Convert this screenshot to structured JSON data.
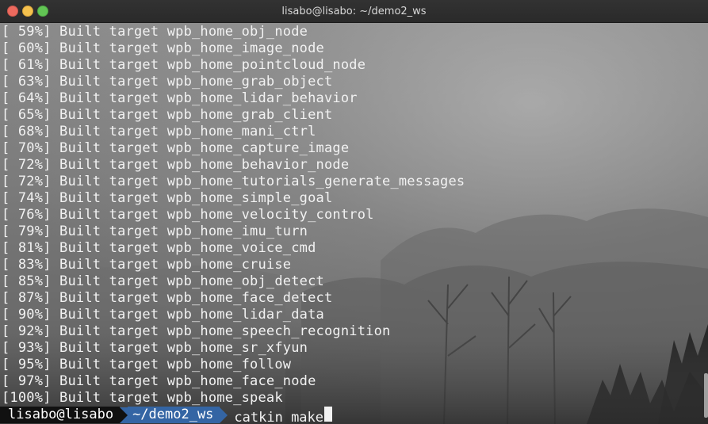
{
  "window": {
    "title": "lisabo@lisabo: ~/demo2_ws"
  },
  "terminal": {
    "lines": [
      "[ 59%] Built target wpb_home_obj_node",
      "[ 60%] Built target wpb_home_image_node",
      "[ 61%] Built target wpb_home_pointcloud_node",
      "[ 63%] Built target wpb_home_grab_object",
      "[ 64%] Built target wpb_home_lidar_behavior",
      "[ 65%] Built target wpb_home_grab_client",
      "[ 68%] Built target wpb_home_mani_ctrl",
      "[ 70%] Built target wpb_home_capture_image",
      "[ 72%] Built target wpb_home_behavior_node",
      "[ 72%] Built target wpb_home_tutorials_generate_messages",
      "[ 74%] Built target wpb_home_simple_goal",
      "[ 76%] Built target wpb_home_velocity_control",
      "[ 79%] Built target wpb_home_imu_turn",
      "[ 81%] Built target wpb_home_voice_cmd",
      "[ 83%] Built target wpb_home_cruise",
      "[ 85%] Built target wpb_home_obj_detect",
      "[ 87%] Built target wpb_home_face_detect",
      "[ 90%] Built target wpb_home_lidar_data",
      "[ 92%] Built target wpb_home_speech_recognition",
      "[ 93%] Built target wpb_home_sr_xfyun",
      "[ 95%] Built target wpb_home_follow",
      "[ 97%] Built target wpb_home_face_node",
      "[100%] Built target wpb_home_speak"
    ],
    "prompt": {
      "user_host": "lisabo@lisabo",
      "path": "~/demo2_ws",
      "command": "catkin_make"
    }
  },
  "colors": {
    "prompt_user_bg": "#111111",
    "prompt_path_bg": "#3465a4",
    "text": "#f2f2f2"
  }
}
